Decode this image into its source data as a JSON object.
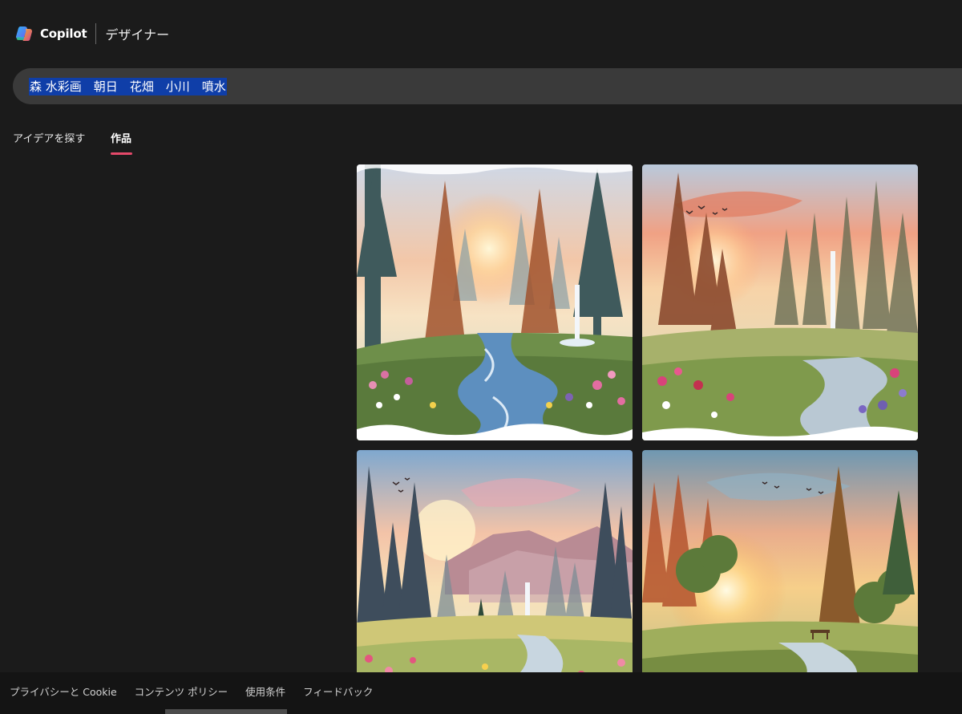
{
  "header": {
    "brand": "Copilot",
    "product": "デザイナー"
  },
  "prompt": {
    "text": "森 水彩画　朝日　花畑　小川　噴水"
  },
  "tabs": [
    {
      "label": "アイデアを探す",
      "active": false
    },
    {
      "label": "作品",
      "active": true
    }
  ],
  "accent_color": "#e5496a",
  "selection_color": "#0f3ea8",
  "images": [
    {
      "subject": "watercolor forest at sunrise with stream, fountain and flowers"
    },
    {
      "subject": "watercolor pine forest with sunrise, fountain, meadow and flowers"
    },
    {
      "subject": "watercolor pine forest with mountains, fountain and flower field"
    },
    {
      "subject": "watercolor forest with sunrise, bench and stream"
    }
  ],
  "footer": {
    "links": [
      "プライバシーと Cookie",
      "コンテンツ ポリシー",
      "使用条件",
      "フィードバック"
    ]
  }
}
